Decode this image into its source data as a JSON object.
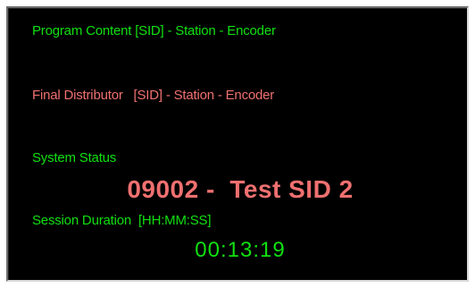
{
  "program_content": {
    "label": "Program Content [SID] - Station - Encoder",
    "value": ""
  },
  "final_distributor": {
    "label": "Final Distributor   [SID] - Station - Encoder",
    "value": ""
  },
  "system_status": {
    "label": "System Status",
    "value": "09002 -  Test SID 2"
  },
  "session_duration": {
    "label": "Session Duration  [HH:MM:SS]",
    "value": "00:13:19"
  },
  "colors": {
    "background": "#000000",
    "green_text": "#11e011",
    "salmon_text": "#f07070"
  }
}
